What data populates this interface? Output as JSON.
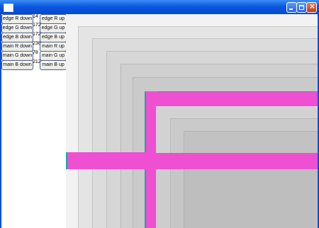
{
  "window": {
    "title": ""
  },
  "controls": [
    {
      "down_label": "edge R down",
      "value": "14",
      "up_label": "edge R up"
    },
    {
      "down_label": "edge G down",
      "value": "172",
      "up_label": "edge G up"
    },
    {
      "down_label": "edge B down",
      "value": "172",
      "up_label": "edge B up"
    },
    {
      "down_label": "main R down",
      "value": "238",
      "up_label": "main R up"
    },
    {
      "down_label": "main G down",
      "value": "78",
      "up_label": "main G up"
    },
    {
      "down_label": "main B down",
      "value": "212",
      "up_label": "main B up"
    }
  ],
  "colors": {
    "title_bar": "#0a56e0",
    "highlight_bar": "#ef4fd1",
    "edge_color": "#0eacac",
    "frame_steps": [
      "#e4e4e4",
      "#dcdcdc",
      "#d6d6d6",
      "#d0d0d0",
      "#cacaca",
      "#c4c4c4"
    ]
  }
}
